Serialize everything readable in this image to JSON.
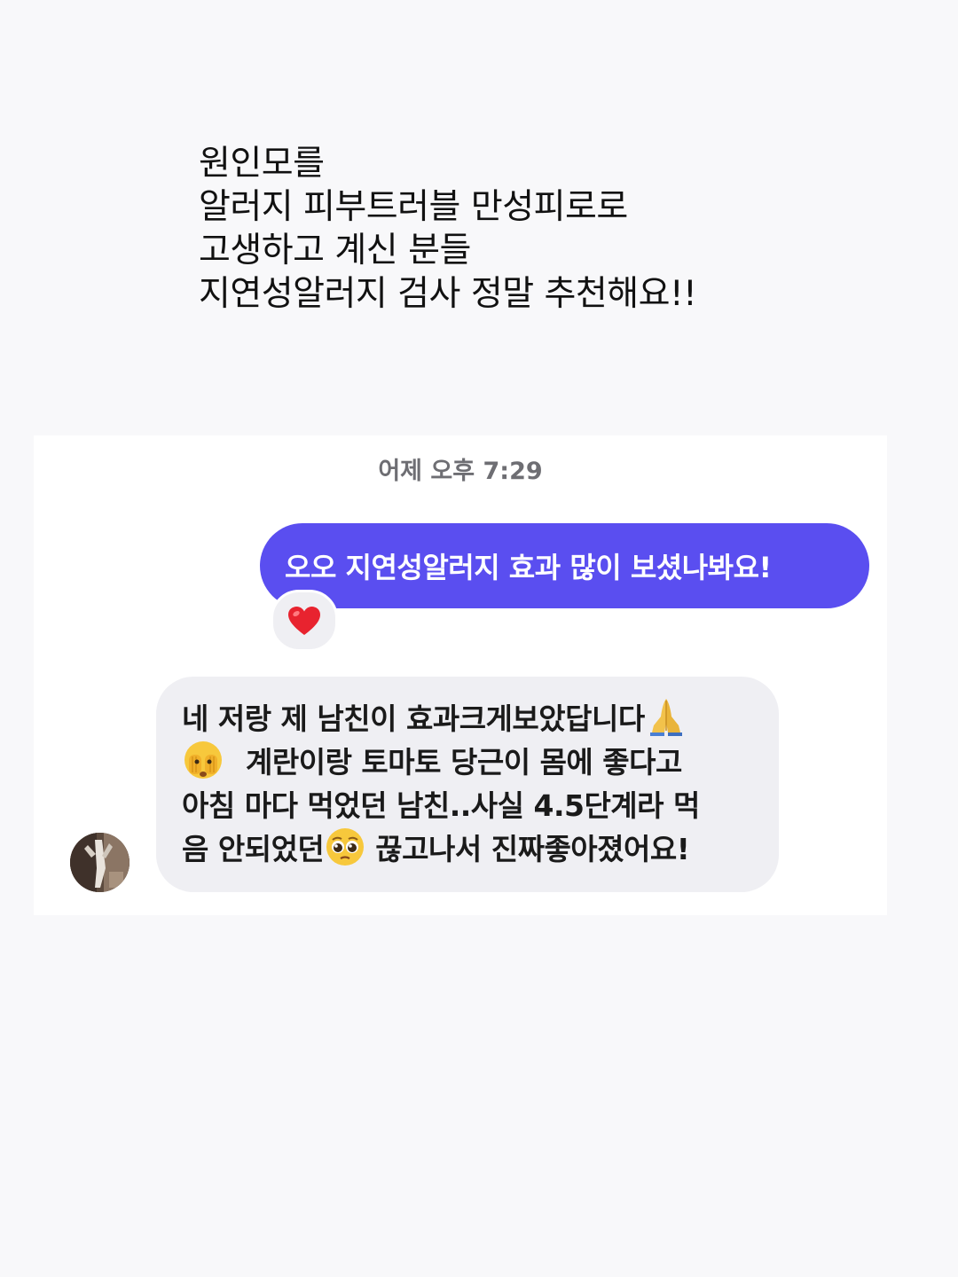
{
  "caption": {
    "lines": [
      "원인모를",
      "알러지 피부트러블 만성피로로",
      "고생하고 계신 분들",
      "지연성알러지 검사 정말 추천해요!!"
    ]
  },
  "chat": {
    "timestamp": "어제 오후 7:29",
    "sent_message": {
      "text": "오오 지연성알러지 효과 많이 보셨나봐요!",
      "bubble_color": "#5a4ef0",
      "reaction_icon": "red-heart-emoji"
    },
    "received_message": {
      "bubble_color": "#efeff3",
      "line1_text": "네 저랑 제 남친이 효과크게보았답니다",
      "line1_emoji": "folded-hands-emoji",
      "line2_emoji": "face-with-peeking-eye-emoji",
      "line2_text": "계란이랑 토마토 당근이  몸에 좋다고",
      "line3_text": "아침 마다 먹었던 남친..사실 4.5단계라 먹",
      "line4_text_a": "음 안되었던",
      "line4_emoji": "pleading-face-emoji",
      "line4_text_b": "끊고나서 진짜좋아졌어요!"
    }
  }
}
